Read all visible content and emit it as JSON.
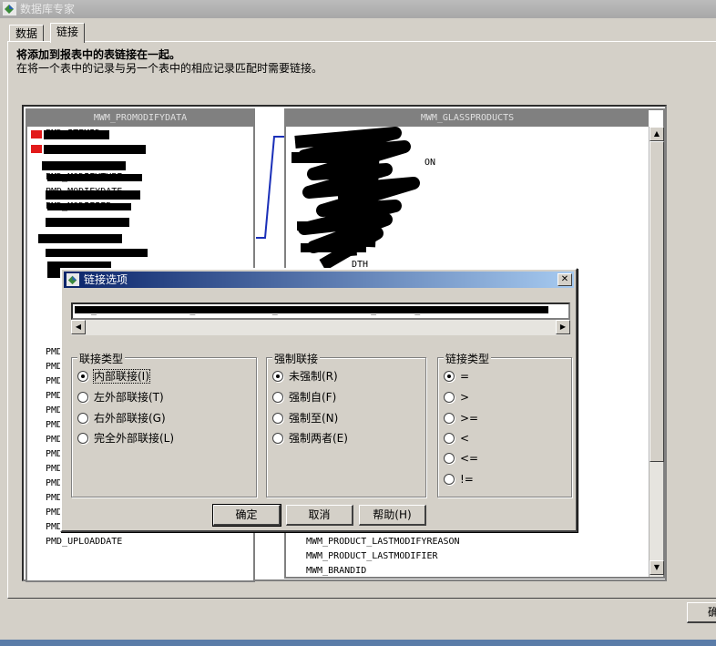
{
  "window": {
    "title": "数据库专家"
  },
  "tabs": [
    {
      "label": "数据"
    },
    {
      "label": "链接"
    }
  ],
  "instructions": {
    "title": "将添加到报表中的表链接在一起。",
    "text": "在将一个表中的记录与另一个表中的相应记录匹配时需要链接。"
  },
  "left_table": {
    "name": "MWM_PROMODIFYDATA",
    "visible_fields": [
      "PMD_ITEMID",
      "PMD_MODIFYTYPE",
      "PMD_MODIFYDATE",
      "PMD_MODIFIER",
      "PMD",
      "PMD",
      "PMD",
      "PMD",
      "PMD",
      "PMD",
      "PMD",
      "PMD",
      "PMD",
      "PMD",
      "PMD",
      "PMD",
      "PMD",
      "PMD_UPLOADDATE"
    ]
  },
  "right_table": {
    "name": "MWM_GLASSPRODUCTS",
    "visible_fields": [
      "TION",
      "ON",
      "DTH",
      "MWM_PRODUCT_LASTMODIFYREASON",
      "MWM_PRODUCT_LASTMODIFIER",
      "MWM_BRANDID"
    ]
  },
  "dialog": {
    "title": "链接选项",
    "close_label": "✕",
    "join_text": "MWM_PROMODIFYDATA.PMD_ITEMID --> MWM_GLASSPRODUCTS.MWM_PRODUCT_ITEMID",
    "join_type": {
      "title": "联接类型",
      "options": [
        "内部联接(I)",
        "左外部联接(T)",
        "右外部联接(G)",
        "完全外部联接(L)"
      ],
      "selected": 0
    },
    "enforce": {
      "title": "强制联接",
      "options": [
        "未强制(R)",
        "强制自(F)",
        "强制至(N)",
        "强制两者(E)"
      ],
      "selected": 0
    },
    "link_type": {
      "title": "链接类型",
      "options": [
        "=",
        ">",
        ">=",
        "<",
        "<=",
        "!="
      ],
      "selected": 0
    },
    "buttons": {
      "ok": "确定",
      "cancel": "取消",
      "help": "帮助(H)"
    }
  },
  "bottom_button": {
    "label": "确"
  },
  "icons": {
    "app": "database-expert-icon",
    "close": "close-icon"
  }
}
